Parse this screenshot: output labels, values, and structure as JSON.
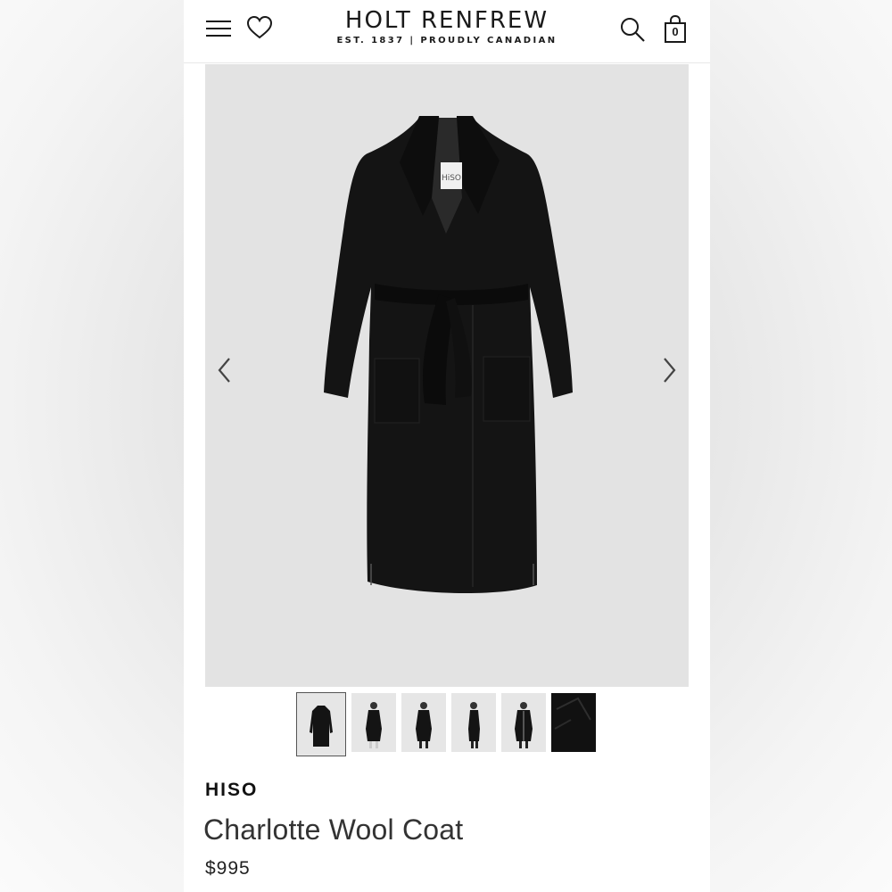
{
  "header": {
    "logo": "HOLT RENFREW",
    "tagline": "EST. 1837 | PROUDLY CANADIAN",
    "bag_count": "0",
    "icons": [
      "menu-icon",
      "heart-icon",
      "search-icon",
      "shopping-bag-icon"
    ]
  },
  "gallery": {
    "label_tag": "HiSO",
    "thumbnail_count": 6,
    "selected_index": 0,
    "prev_icon": "chevron-left-icon",
    "next_icon": "chevron-right-icon"
  },
  "product": {
    "brand": "HISO",
    "name": "Charlotte Wool Coat",
    "price": "$995"
  },
  "colors": {
    "hero_bg": "#e3e3e3",
    "coat": "#141414",
    "text": "#1a1a1a"
  }
}
